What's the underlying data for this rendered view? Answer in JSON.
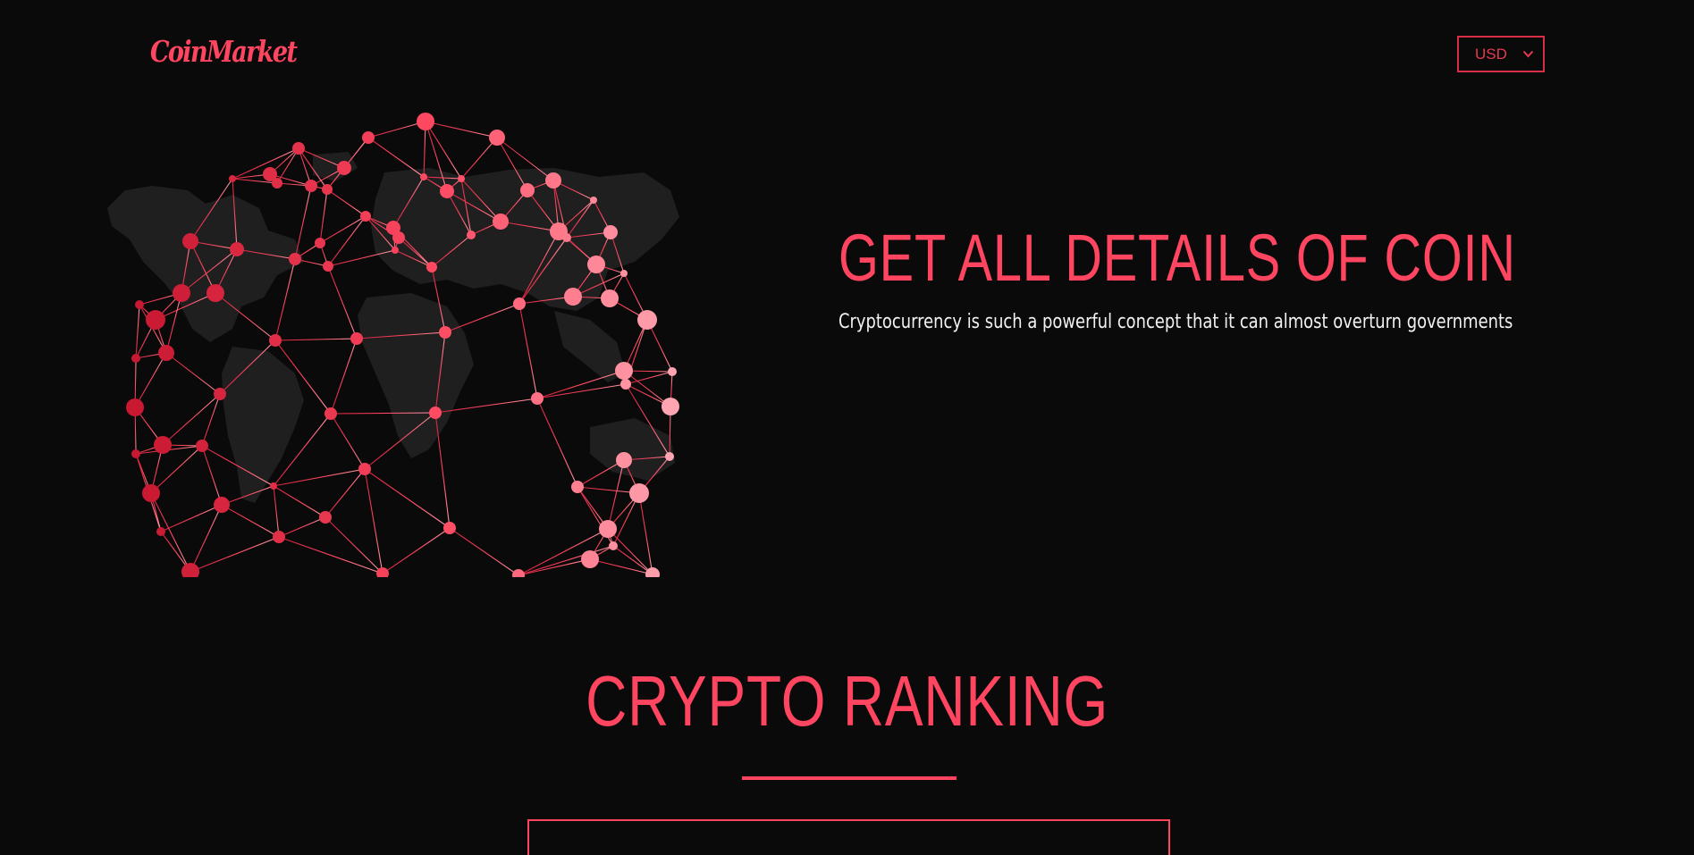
{
  "navbar": {
    "logo": "CoinMarket",
    "currency": {
      "selected": "USD",
      "icon": "chevron-down-icon"
    }
  },
  "hero": {
    "title": "GET ALL DETAILS OF COIN",
    "subtitle": "Cryptocurrency is such a powerful concept that it can almost overturn governments",
    "image": "globe-network-illustration"
  },
  "ranking": {
    "title": "CRYPTO RANKING"
  },
  "colors": {
    "background": "#0a0a0a",
    "accent": "#ff4560",
    "accent_dark": "#d31f3c",
    "accent_light": "#ffa0ac",
    "text": "#f2f2f2"
  }
}
